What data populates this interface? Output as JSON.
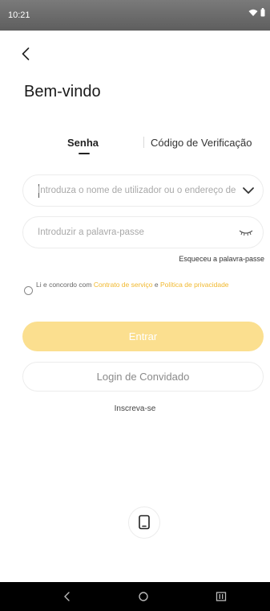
{
  "status_bar": {
    "time": "10:21"
  },
  "title": "Bem-vindo",
  "tabs": [
    {
      "label": "Senha",
      "active": true
    },
    {
      "label": "Código de Verificação",
      "active": false
    }
  ],
  "username_field": {
    "placeholder": "Introduza o nome de utilizador ou o endereço de"
  },
  "password_field": {
    "placeholder": "Introduzir a palavra-passe"
  },
  "forgot_password": "Esqueceu a palavra-passe",
  "agreement": {
    "prefix": "Li e concordo com",
    "service_link": "Contrato de serviço",
    "conjunction": "e",
    "privacy_link": "Política de privacidade"
  },
  "login_button": "Entrar",
  "guest_button": "Login de Convidado",
  "register_link": "Inscreva-se",
  "colors": {
    "accent": "#f1b82d",
    "login_button_bg": "#fbdf8f"
  },
  "icons": [
    "back-arrow-icon",
    "chevron-down-icon",
    "closed-eye-icon",
    "phone-device-icon",
    "wifi-icon",
    "battery-icon"
  ]
}
